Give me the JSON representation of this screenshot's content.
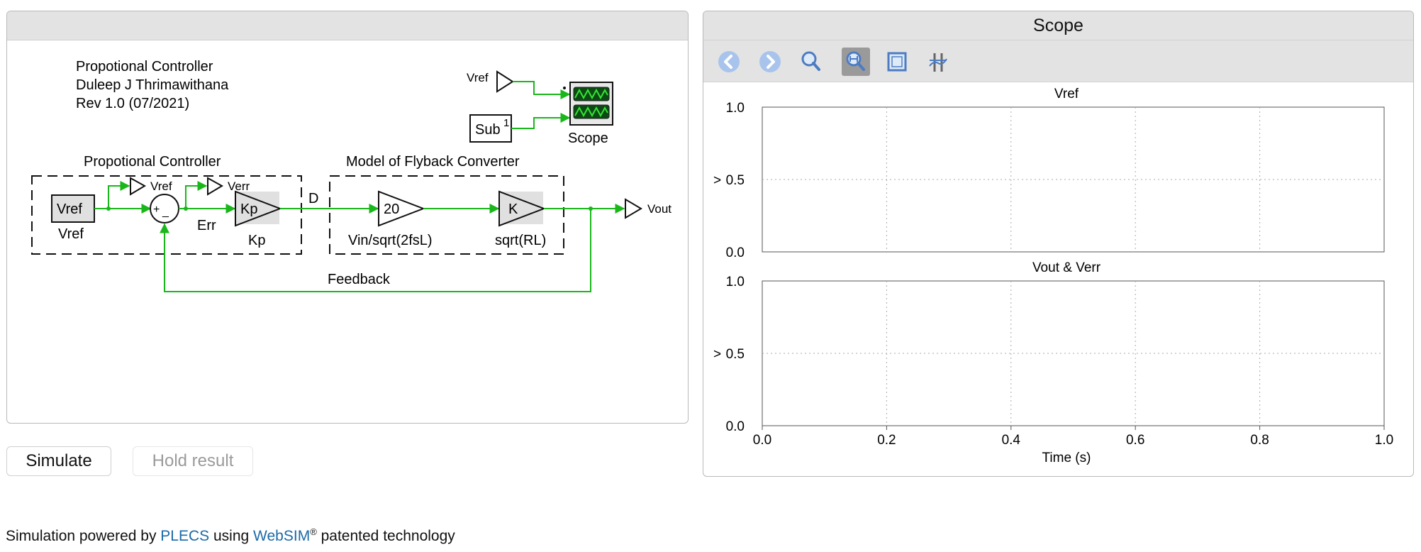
{
  "model": {
    "header_lines": [
      "Propotional Controller",
      "Duleep J Thrimawithana",
      "Rev 1.0 (07/2021)"
    ],
    "scope_block": {
      "input_vref": "Vref",
      "sub_label": "Sub",
      "sub_index": "1",
      "label": "Scope"
    },
    "groups": {
      "controller_title": "Propotional Controller",
      "plant_title": "Model of Flyback Converter"
    },
    "blocks": {
      "vref_const": "Vref",
      "vref_const_label": "Vref",
      "goto_vref": "Vref",
      "goto_verr": "Verr",
      "sum_plus": "+",
      "sum_minus": "_",
      "err_label": "Err",
      "kp_gain": "Kp",
      "kp_label": "Kp",
      "d_label": "D",
      "gain20": "20",
      "gain20_label": "Vin/sqrt(2fsL)",
      "gainK": "K",
      "gainK_label": "sqrt(RL)",
      "vout_goto": "Vout",
      "feedback_label": "Feedback"
    },
    "colors": {
      "wire": "#19b719",
      "block_fill": "#e0e0e0",
      "scope_screen": "#0b4a12"
    }
  },
  "scope": {
    "title": "Scope",
    "toolbar": [
      {
        "name": "back-icon",
        "active": false
      },
      {
        "name": "forward-icon",
        "active": false
      },
      {
        "name": "zoom-icon",
        "active": false
      },
      {
        "name": "zoom-x-icon",
        "active": true
      },
      {
        "name": "fit-view-icon",
        "active": false
      },
      {
        "name": "cursor-icon",
        "active": false
      }
    ],
    "plots": [
      {
        "title": "Vref",
        "ylabel": ">",
        "yticks": [
          "1.0",
          "0.5",
          "0.0"
        ]
      },
      {
        "title": "Vout & Verr",
        "ylabel": ">",
        "yticks": [
          "1.0",
          "0.5",
          "0.0"
        ]
      }
    ],
    "xticks": [
      "0.0",
      "0.2",
      "0.4",
      "0.6",
      "0.8",
      "1.0"
    ],
    "xlabel": "Time (s)"
  },
  "buttons": {
    "simulate": "Simulate",
    "hold": "Hold result"
  },
  "footer": {
    "prefix": "Simulation powered by ",
    "plecs": "PLECS",
    "middle": " using ",
    "websim": "WebSIM",
    "reg": "®",
    "suffix": " patented technology"
  }
}
